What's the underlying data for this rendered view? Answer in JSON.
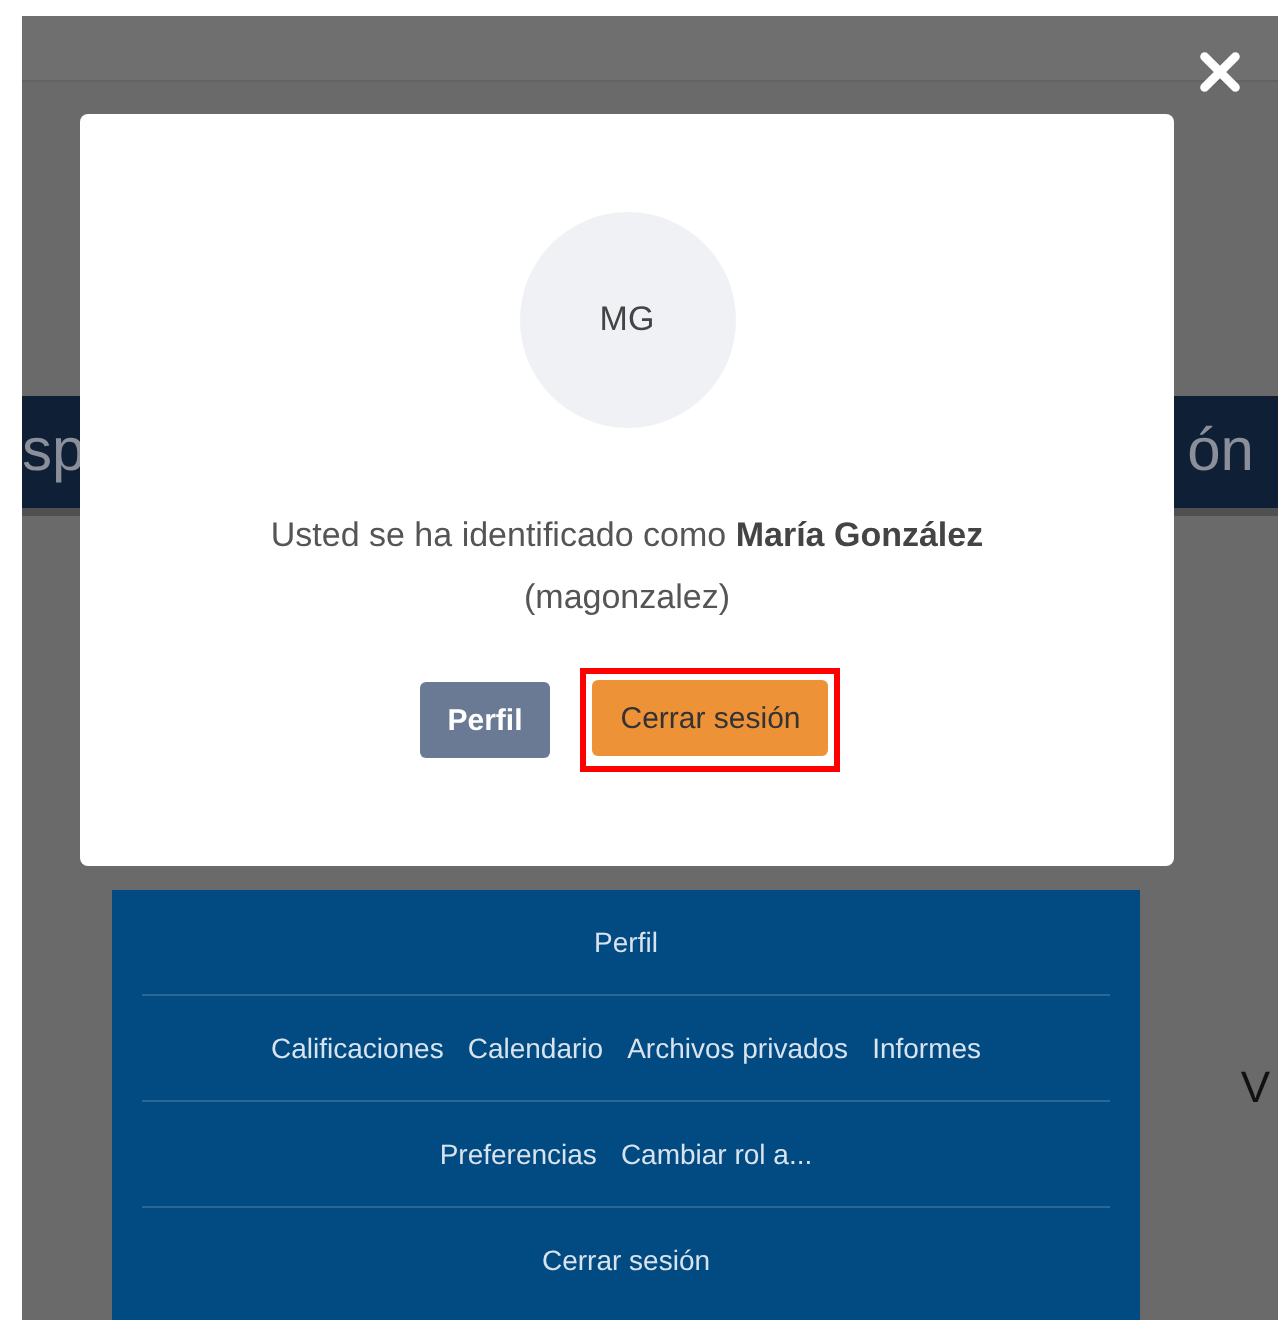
{
  "background": {
    "nav_left": "sp",
    "nav_right": "ón",
    "side_text": "V",
    "menu_rows": [
      [
        "Perfil"
      ],
      [
        "Calificaciones",
        "Calendario",
        "Archivos privados",
        "Informes"
      ],
      [
        "Preferencias",
        "Cambiar rol a..."
      ],
      [
        "Cerrar sesión"
      ]
    ]
  },
  "modal": {
    "avatar_initials": "MG",
    "message": "Usted se ha identificado como **María González** (magonzalez)",
    "buttons": [
      {
        "label": "Perfil",
        "kind": "secondary",
        "highlighted": false
      },
      {
        "label": "Cerrar sesión",
        "kind": "primary",
        "highlighted": true
      }
    ]
  }
}
